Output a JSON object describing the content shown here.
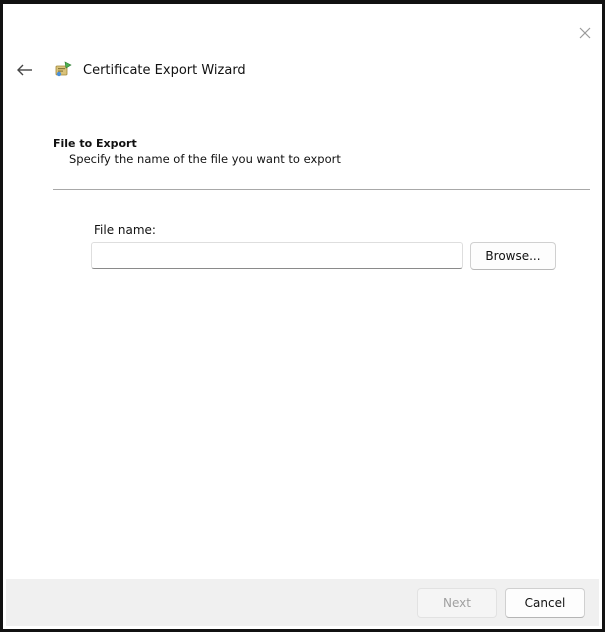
{
  "window": {
    "title": "Certificate Export Wizard",
    "close_icon": "close-icon",
    "back_icon": "back-arrow-icon",
    "title_icon": "certificate-wizard-icon"
  },
  "section": {
    "title": "File to Export",
    "subtitle": "Specify the name of the file you want to export"
  },
  "file_field": {
    "label": "File name:",
    "value": "",
    "placeholder": "",
    "browse_label": "Browse..."
  },
  "footer": {
    "next_label": "Next",
    "cancel_label": "Cancel",
    "next_enabled": false
  }
}
